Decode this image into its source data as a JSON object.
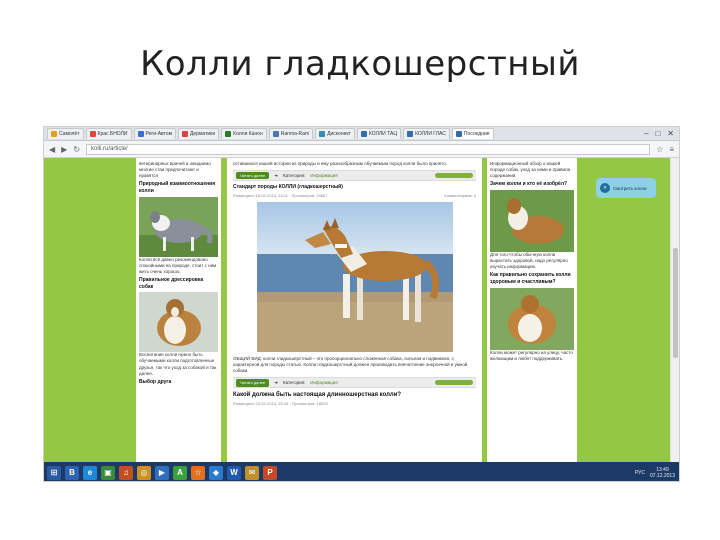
{
  "slide": {
    "title": "Колли гладкошерстный"
  },
  "browser": {
    "tabs": [
      {
        "label": "Самолёт",
        "color": "#e0a020"
      },
      {
        "label": "Крас БНОЛИ",
        "color": "#d94a3a"
      },
      {
        "label": "Реги-Автом",
        "color": "#3b6fd1"
      },
      {
        "label": "Дерматики",
        "color": "#e04040"
      },
      {
        "label": "Колли Канон",
        "color": "#2a7b2a"
      },
      {
        "label": "Ranma-Ram",
        "color": "#4a76b5"
      },
      {
        "label": "Дисконект",
        "color": "#2c8fbf"
      },
      {
        "label": "КОЛЛИ ТАЦ",
        "color": "#2f6db0"
      },
      {
        "label": "КОЛЛИ ГЛАС",
        "color": "#2f6db0"
      },
      {
        "label": "Последние",
        "color": "#2f6db0"
      }
    ],
    "url": "kolli.ru/article/",
    "window_controls": [
      "–",
      "□",
      "✕"
    ]
  },
  "page": {
    "left": {
      "top_text": "ветеринарных врачей и ожидаемо многие стаи предпочитают и нравятся",
      "heading1": "Природный взаимоотношения колли",
      "text1": "Колли всё давно рекомендовано спокойными на природе, стоит с ним жить очень хорошо.",
      "heading2": "Правильное дрессировка собак",
      "text2": "Воспитание колли нужно быть обучаемыми колли подготовленные друзья, так что уход за собакой и так далее.",
      "heading3": "Выбор друга"
    },
    "main": {
      "intro": "оставшихся нашей истории из природы и ему разнообразным обучаемым пород колли было принято.",
      "read_more": "Читать далее",
      "category_label": "Категория:",
      "category": "Информация",
      "article_title": "Стандарт породы КОЛЛИ (гладкошерстный)",
      "article_meta": "Размещено 15-02-2013, 14:11 · Просмотров: 29867",
      "comments": "Комментариев: 0",
      "body": "ОБЩИЙ ВИД: колли гладкошерстный – это пропорционально сложенная собака, сильная и подвижная, с характерной для породы статью. Колли гладкошерстный должен производить впечатление энергичной и умной собаки.",
      "article2_title": "Какой должна быть настоящая длинношерстная колли?",
      "article2_meta": "Размещено 23-02-2013, 15:45 · Просмотров: 18529"
    },
    "right": {
      "top_text": "Информационный обзор о нашей породе собак, уход за ними и правила содержания.",
      "heading1": "Зачем колли и кто её изобрёл?",
      "text1": "Для того чтобы обычную колли вырастить здоровой, надо регулярно изучать информацию.",
      "heading2": "Как правильно сохранить колли здоровым и счастливым?",
      "text2": "Колли может регулярно на улицу, часто желающим и любят поддерживать."
    },
    "widget": {
      "label": "Смотреть колли"
    }
  },
  "taskbar": {
    "apps": [
      {
        "label": "⊞",
        "color": "#2a5aa0"
      },
      {
        "label": "В",
        "color": "#2e62b5"
      },
      {
        "label": "e",
        "color": "#1e88d8"
      },
      {
        "label": "▣",
        "color": "#3a8a3a"
      },
      {
        "label": "♫",
        "color": "#c05020"
      },
      {
        "label": "◎",
        "color": "#d09020"
      },
      {
        "label": "▶",
        "color": "#2f6fc0"
      },
      {
        "label": "A",
        "color": "#3aa03a"
      },
      {
        "label": "☆",
        "color": "#e07020"
      },
      {
        "label": "◆",
        "color": "#2a7ad0"
      },
      {
        "label": "W",
        "color": "#1f5ab0"
      },
      {
        "label": "✉",
        "color": "#c0902a"
      },
      {
        "label": "P",
        "color": "#c44a2a"
      }
    ],
    "lang": "РУС",
    "time": "13:49",
    "date": "07.12.2013"
  }
}
